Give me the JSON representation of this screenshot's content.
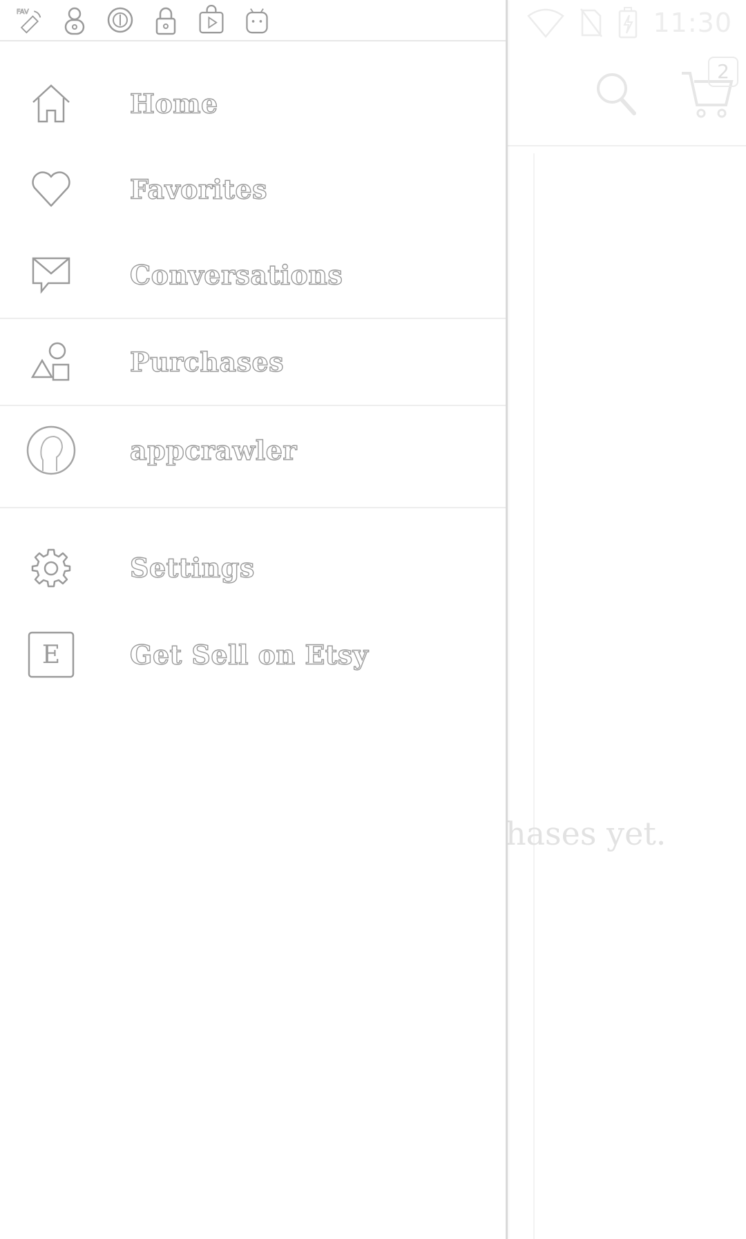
{
  "status_bar": {
    "time": "11:30",
    "left_icons": [
      "fav-satellite-icon",
      "padlock-8-icon",
      "circle-stop-icon",
      "lock-icon",
      "play-bag-icon",
      "android-robot-icon"
    ],
    "right_icons": [
      "wifi-icon",
      "no-sim-icon",
      "battery-charging-icon"
    ]
  },
  "drawer": {
    "items": [
      {
        "label": "Home",
        "icon": "home-icon"
      },
      {
        "label": "Favorites",
        "icon": "heart-icon"
      },
      {
        "label": "Conversations",
        "icon": "message-icon"
      },
      {
        "label": "Purchases",
        "icon": "shapes-icon",
        "selected": true
      },
      {
        "label": "appcrawler",
        "icon": "avatar-icon"
      },
      {
        "label": "Settings",
        "icon": "gear-icon"
      },
      {
        "label": "Get Sell on Etsy",
        "icon": "etsy-e-icon"
      }
    ]
  },
  "background": {
    "cart_count": "2",
    "empty_message": "hases yet.",
    "search_icon": "search-icon",
    "cart_icon": "cart-icon"
  }
}
